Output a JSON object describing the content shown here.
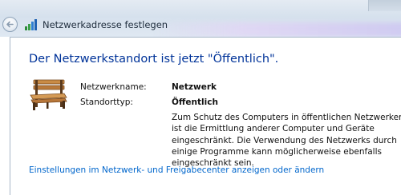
{
  "window": {
    "title": "Netzwerkadresse festlegen"
  },
  "heading": "Der Netzwerkstandort ist jetzt \"Öffentlich\".",
  "details": {
    "network_name_label": "Netzwerkname:",
    "network_name_value": "Netzwerk",
    "location_type_label": "Standorttyp:",
    "location_type_value": "Öffentlich",
    "description_lines": [
      "Zum Schutz des Computers in öffentlichen Netzwerken",
      "ist die Ermittlung anderer Computer und Geräte",
      "eingeschränkt. Die Verwendung des Netzwerks durch",
      "einige Programme kann möglicherweise ebenfalls",
      "eingeschränkt sein."
    ]
  },
  "link": "Einstellungen im Netzwerk- und Freigabecenter anzeigen oder ändern",
  "icons": {
    "back": "back-arrow-icon",
    "network": "network-icon",
    "bench": "park-bench-icon"
  },
  "colors": {
    "heading": "#003399",
    "link": "#0066cc",
    "titlebar": "#d6e1ed"
  }
}
